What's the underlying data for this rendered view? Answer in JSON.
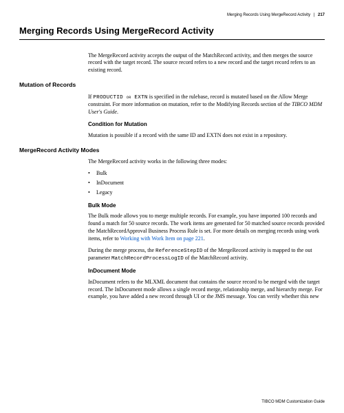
{
  "header": {
    "running": "Merging Records Using MergeRecord Activity",
    "page": "217"
  },
  "title": "Merging Records Using MergeRecord Activity",
  "intro": "The MergeRecord activity accepts the output of the MatchRecord activity, and then merges the source record with the target record. The source record refers to a new record and the target record refers to an existing record.",
  "mutation": {
    "heading": "Mutation of Records",
    "p_pre": "If ",
    "code": "PRODUCTID or EXTN",
    "p_post": " is specified in the rulebase, record is mutated based on the Allow Merge constraint. For more information on mutation, refer to the Modifying Records section of the ",
    "book": "TIBCO MDM  User's Guide",
    "p_end": ".",
    "cond_heading": "Condition for Mutation",
    "cond_text": "Mutation is possible if a record with the same ID and EXTN does not exist in a repository."
  },
  "modes": {
    "heading": "MergeRecord Activity Modes",
    "intro": "The MergeRecord activity works in the following three modes:",
    "items": [
      "Bulk",
      "InDocument",
      "Legacy"
    ],
    "bulk": {
      "heading": "Bulk Mode",
      "p1_a": "The Bulk mode allows you to merge multiple records. For example, you have imported 100 records and found a match for 50 source records. The work items are generated for 50 matched source records provided the MatchRecordApproval Business Process Rule is set. For more details on merging records using work items, refer to ",
      "link": "Working with Work Item on page 221",
      "p1_b": ".",
      "p2_a": "During the merge process, the ",
      "code1": "ReferenceStepID",
      "p2_b": " of the MergeRecord activity is mapped to the out parameter ",
      "code2": "MatchRecordProcessLogID",
      "p2_c": " of the MatchRecord activity."
    },
    "indoc": {
      "heading": "InDocument Mode",
      "text": "InDocument refers to the MLXML document that contains the source record to be merged with the target record. The InDocument mode allows a single record merge, relationship merge, and hierarchy merge. For example, you have added a new record through UI or the JMS message. You can verify whether this new"
    }
  },
  "footer": "TIBCO MDM Customization Guide"
}
